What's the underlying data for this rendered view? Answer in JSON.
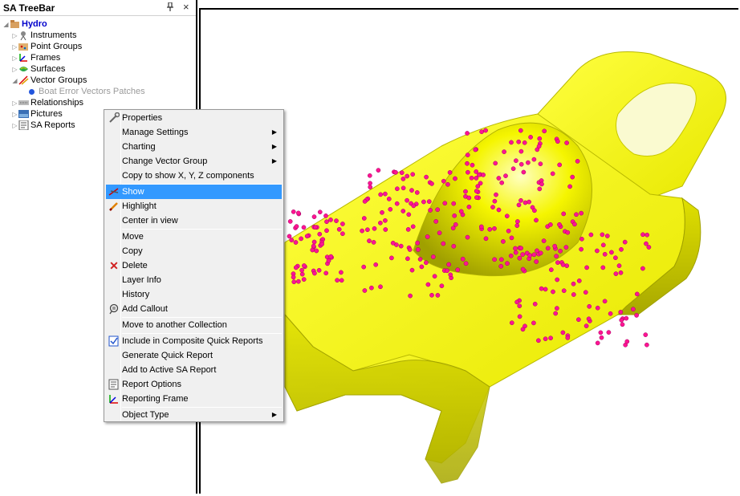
{
  "treebar": {
    "title": "SA TreeBar",
    "pin_icon": "◆",
    "close_icon": "×",
    "items": [
      {
        "label": "Hydro"
      },
      {
        "label": "Instruments"
      },
      {
        "label": "Point Groups"
      },
      {
        "label": "Frames"
      },
      {
        "label": "Surfaces"
      },
      {
        "label": "Vector Groups"
      },
      {
        "label": "Boat Error Vectors Patches"
      },
      {
        "label": "Relationships"
      },
      {
        "label": "Pictures"
      },
      {
        "label": "SA Reports"
      }
    ]
  },
  "context_menu": {
    "items": [
      {
        "label": "Properties"
      },
      {
        "label": "Manage Settings"
      },
      {
        "label": "Charting"
      },
      {
        "label": "Change Vector Group"
      },
      {
        "label": "Copy to show X, Y, Z components"
      },
      {
        "label": "Show"
      },
      {
        "label": "Highlight"
      },
      {
        "label": "Center in view"
      },
      {
        "label": "Move"
      },
      {
        "label": "Copy"
      },
      {
        "label": "Delete"
      },
      {
        "label": "Layer Info"
      },
      {
        "label": "History"
      },
      {
        "label": "Add Callout"
      },
      {
        "label": "Move to another Collection"
      },
      {
        "label": "Include in Composite Quick Reports"
      },
      {
        "label": "Generate Quick Report"
      },
      {
        "label": "Add to Active SA Report"
      },
      {
        "label": "Report Options"
      },
      {
        "label": "Reporting Frame"
      },
      {
        "label": "Object Type"
      }
    ],
    "submenu_arrow": "▶"
  },
  "colors": {
    "model_yellow": "#f5f500",
    "vector_magenta": "#ff1493",
    "highlight": "#3399ff"
  }
}
